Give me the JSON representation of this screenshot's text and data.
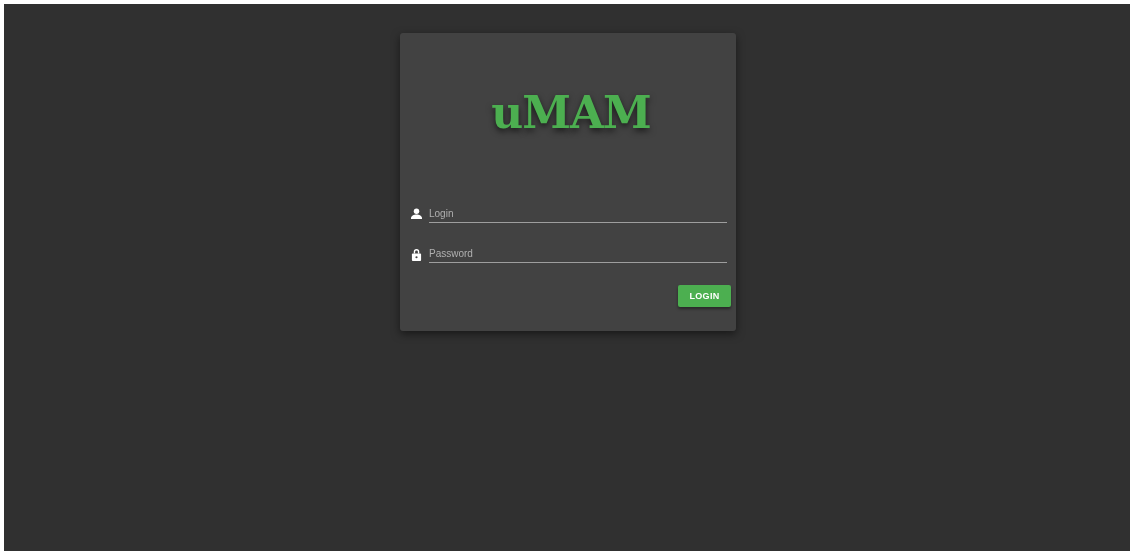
{
  "logo": "uMAM",
  "fields": [
    {
      "kind": "user",
      "placeholder": "Login"
    },
    {
      "kind": "password",
      "placeholder": "Password"
    }
  ],
  "button": "LOGIN"
}
